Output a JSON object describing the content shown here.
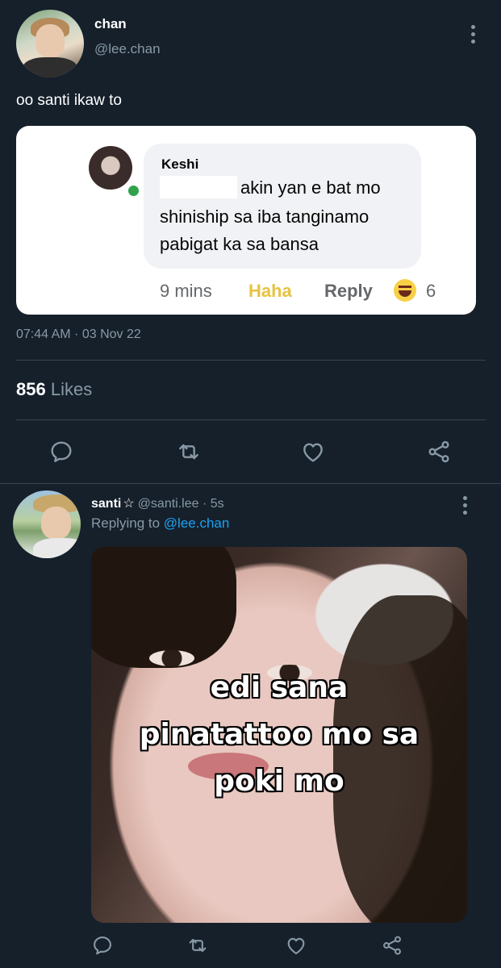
{
  "main_tweet": {
    "author_name": "chan",
    "author_handle": "@lee.chan",
    "text": "oo santi ikaw to",
    "embedded_comment": {
      "author": "Keshi",
      "line1": "akin yan e bat mo",
      "line2": "shiniship sa iba tanginamo",
      "line3": "pabigat ka sa bansa",
      "time": "9 mins",
      "reaction_label": "Haha",
      "reply_label": "Reply",
      "reaction_count": "6"
    },
    "timestamp": "07:44 AM · 03 Nov 22",
    "likes_count": "856",
    "likes_label": "Likes"
  },
  "reply_tweet": {
    "author_name": "santi",
    "star": "☆",
    "handle_time": "@santi.lee · 5s",
    "replying_prefix": "Replying to",
    "replying_to": "@lee.chan",
    "meme_lines": [
      "edi sana",
      "pinatattoo mo sa",
      "poki mo"
    ]
  },
  "icons": [
    "more-icon",
    "reply-icon",
    "retweet-icon",
    "like-icon",
    "share-icon",
    "star-icon",
    "haha-icon"
  ],
  "colors": {
    "background": "#15202b",
    "secondary_text": "#8899a6",
    "link": "#1da1f2",
    "divider": "#38444d"
  }
}
